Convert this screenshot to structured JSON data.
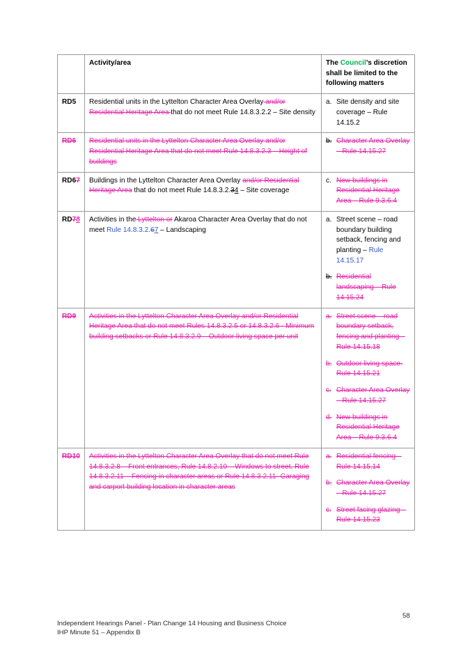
{
  "document": {
    "page_number": "58",
    "footer_line_1": "Independent Hearings Panel - Plan Change 14 Housing and Business Choice",
    "footer_line_2": "IHP Minute 51 – Appendix B"
  },
  "colors": {
    "tracked_change": "#E224A8",
    "hyperlink": "#3355CC",
    "highlight_green": "#00B050",
    "grid": "#9a9a9a"
  },
  "table": {
    "header": {
      "col1": "",
      "col2": "Activity/area",
      "col3_pre": "The ",
      "col3_green": "Council",
      "col3_post": "’s discretion shall be limited to the following matters"
    },
    "rows": [
      {
        "ref": {
          "keep": "RD5",
          "deleted": "",
          "inserted": ""
        },
        "activity": {
          "t1": "Residential units in the Lyttelton Character Area Overlay",
          "d1": " and/or Residential Heritage Area ",
          "t2": "that do not meet Rule 14.8.3.2.2 – Site density"
        },
        "matters": [
          {
            "marker": "a.",
            "text": "Site density and site coverage – Rule 14.15.2",
            "struck": false
          }
        ]
      },
      {
        "ref": {
          "keep": "",
          "deleted": "RD6",
          "inserted": ""
        },
        "activity_struck": "Residential units in the Lyttelton Character Area Overlay and/or Residential Heritage Area that do not meet Rule 14.8.3.2.3 – Height of buildings",
        "matters": [
          {
            "marker": "b.",
            "text": "Character Area Overlay – Rule 14.15.27",
            "struck": true
          }
        ]
      },
      {
        "ref": {
          "keep": "RD6",
          "deleted": "7",
          "inserted": ""
        },
        "activity": {
          "t1": "Buildings in the Lyttelton Character Area Overlay ",
          "d1": "and/or Residential Heritage Area",
          "t2": " that do not meet Rule 14.8.3.2.",
          "dk": "3",
          "ik": "4",
          "t3": " – Site coverage"
        },
        "matters": [
          {
            "marker": "c.",
            "text": "New buildings in Residential Heritage Area – Rule 9.3.6.4",
            "struck": true
          }
        ]
      },
      {
        "ref": {
          "keep": "RD",
          "deleted": "7",
          "inserted": "8"
        },
        "activity": {
          "t1": "Activities in the",
          "d1": " Lyttelton or",
          "t2": " Akaroa Character Area Overlay that do not meet ",
          "blue1": "Rule 14.8.3.2.",
          "blue_del": "6",
          "blue_ins": "7",
          "t3": " – Landscaping"
        },
        "matters": [
          {
            "marker": "a.",
            "pre": "Street scene – road boundary building setback, fencing and planting – ",
            "link": "Rule 14.15.17",
            "struck": false
          },
          {
            "marker": "b.",
            "text": "Residential landscaping – Rule 14.15.24",
            "struck": true
          }
        ]
      },
      {
        "ref": {
          "keep": "",
          "deleted": "RD9",
          "inserted": ""
        },
        "activity_struck": "Activities in the Lyttelton Character Area Overlay and/or Residential Heritage Area that do not meet Rules 14.8.3.2.5 or 14.8.3.2.6 -  Minimum building setbacks or Rule 14.8.3.2.9 – Outdoor living space per unit",
        "matters": [
          {
            "marker": "a.",
            "text": "Street scene – road boundary setback, fencing and planting – Rule 14.15.18",
            "struck": true
          },
          {
            "marker": "b.",
            "text": "Outdoor living space- Rule 14.15.21",
            "struck": true
          },
          {
            "marker": "c.",
            "text": "Character Area Overlay – Rule 14.15.27",
            "struck": true
          },
          {
            "marker": "d.",
            "text": "New buildings in Residential Heritage Area – Rule 9.3.6.4",
            "struck": true
          }
        ]
      },
      {
        "ref": {
          "keep": "",
          "deleted": "RD10",
          "inserted": ""
        },
        "activity_struck": "Activities in the Lyttelton Character Area Overlay  that do not meet Rule 14.8.3.2.8 – Front entrances, Rule 14.8.2.10 – Windows to street, Rule 14.8.3.2.11 – Fencing in character areas or Rule 14.8.3.2.11- Garaging and carport building location in character areas",
        "matters": [
          {
            "marker": "a.",
            "text": "Residential fencing – Rule 14.15.14",
            "struck": true
          },
          {
            "marker": "b.",
            "text": "Character Area Overlay – Rule 14.15.27",
            "struck": true
          },
          {
            "marker": "c.",
            "text": "Street facing glazing – Rule 14.15.23",
            "struck": true
          }
        ]
      }
    ]
  }
}
